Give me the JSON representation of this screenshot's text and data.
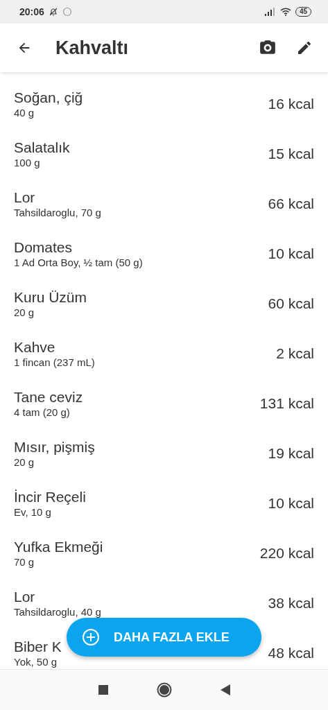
{
  "status_bar": {
    "time": "20:06",
    "battery": "45"
  },
  "app_bar": {
    "title": "Kahvaltı"
  },
  "items": [
    {
      "name": "Soğan, çiğ",
      "detail": "40 g",
      "calories": "16 kcal"
    },
    {
      "name": "Salatalık",
      "detail": "100 g",
      "calories": "15 kcal"
    },
    {
      "name": "Lor",
      "detail": "Tahsildaroglu, 70 g",
      "calories": "66 kcal"
    },
    {
      "name": "Domates",
      "detail": "1 Ad Orta Boy, ½ tam (50 g)",
      "calories": "10 kcal"
    },
    {
      "name": "Kuru Üzüm",
      "detail": "20 g",
      "calories": "60 kcal"
    },
    {
      "name": "Kahve",
      "detail": "1 fincan (237 mL)",
      "calories": "2 kcal"
    },
    {
      "name": "Tane ceviz",
      "detail": "4 tam (20 g)",
      "calories": "131 kcal"
    },
    {
      "name": "Mısır, pişmiş",
      "detail": "20 g",
      "calories": "19 kcal"
    },
    {
      "name": "İncir Reçeli",
      "detail": "Ev, 10 g",
      "calories": "10 kcal"
    },
    {
      "name": "Yufka Ekmeği",
      "detail": "70 g",
      "calories": "220 kcal"
    },
    {
      "name": "Lor",
      "detail": "Tahsildaroglu, 40 g",
      "calories": "38 kcal"
    },
    {
      "name": "Biber K",
      "detail": "Yok, 50 g",
      "calories": "48 kcal"
    }
  ],
  "fab": {
    "label": "DAHA FAZLA EKLE"
  }
}
